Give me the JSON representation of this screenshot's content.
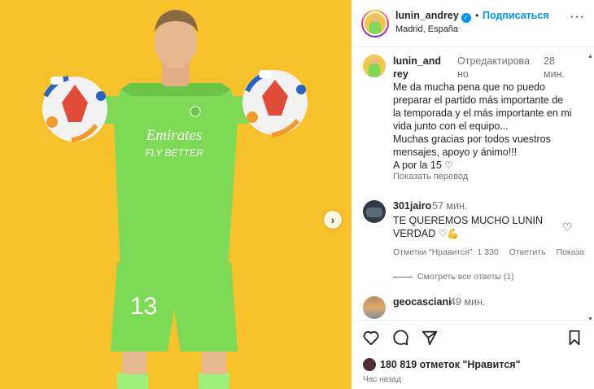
{
  "header": {
    "username": "lunin_andrey",
    "separator": "•",
    "follow_label": "Подписаться",
    "location": "Madrid, España",
    "more": "···"
  },
  "caption": {
    "username": "lunin_andrey",
    "edited_label": "Отредактирова\nно",
    "time": "28 мин.",
    "lines": [
      "Me da mucha pena que no puedo",
      "preparar el partido más importante de",
      "la temporada y el más importante en mi",
      "vida junto con el equipo...",
      "Muchas gracias por todos vuestros",
      "mensajes, apoyo y ánimo!!!",
      "A por la 15"
    ],
    "translate_label": "Показать перевод"
  },
  "comment1": {
    "username": "301jairo",
    "time": "57 мин.",
    "text_line1": "TE QUEREMOS MUCHO LUNIN",
    "text_line2": "VERDAD",
    "likes_label": "Отметки \"Нравится\": 1 330",
    "reply_label": "Ответить",
    "show_label": "Показа",
    "replies_label": "Смотреть все ответы (1)"
  },
  "comment2": {
    "username": "geocasciani",
    "time": "49 мин."
  },
  "post": {
    "likes": "180 819 отметок \"Нравится\"",
    "posted": "Час назад"
  },
  "jersey": {
    "sponsor_line1": "Emirates",
    "sponsor_line2": "FLY BETTER",
    "number": "13"
  },
  "icons": [
    "chevron-right-icon",
    "verified-icon",
    "heart-icon",
    "comment-icon",
    "share-icon",
    "bookmark-icon"
  ],
  "colors": {
    "accent": "#0095f6",
    "background_media": "#f6c12b",
    "kit": "#7ed957"
  }
}
